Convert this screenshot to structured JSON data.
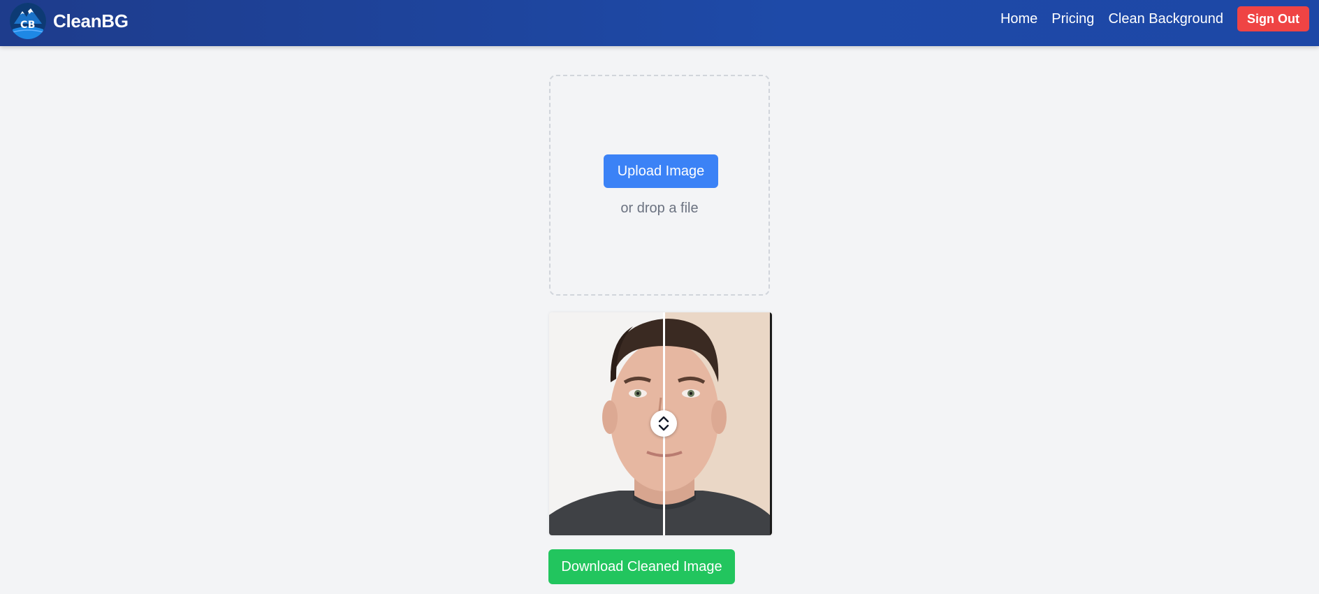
{
  "app": {
    "brand_name": "CleanBG",
    "logo_text": "CB"
  },
  "nav": {
    "links": [
      {
        "label": "Home"
      },
      {
        "label": "Pricing"
      },
      {
        "label": "Clean Background"
      }
    ],
    "signout_label": "Sign Out"
  },
  "upload": {
    "button_label": "Upload Image",
    "drop_text": "or drop a file"
  },
  "comparison": {
    "image_subject": "portrait photo of a man (before/after background removal)",
    "slider_position": 0.51,
    "handle_icon": "chevron-up-down-icon"
  },
  "download": {
    "button_label": "Download Cleaned Image"
  },
  "colors": {
    "navbar": "#1e4aa8",
    "signout": "#ef4444",
    "upload": "#3b82f6",
    "download": "#22c55e",
    "background": "#f3f4f6"
  }
}
